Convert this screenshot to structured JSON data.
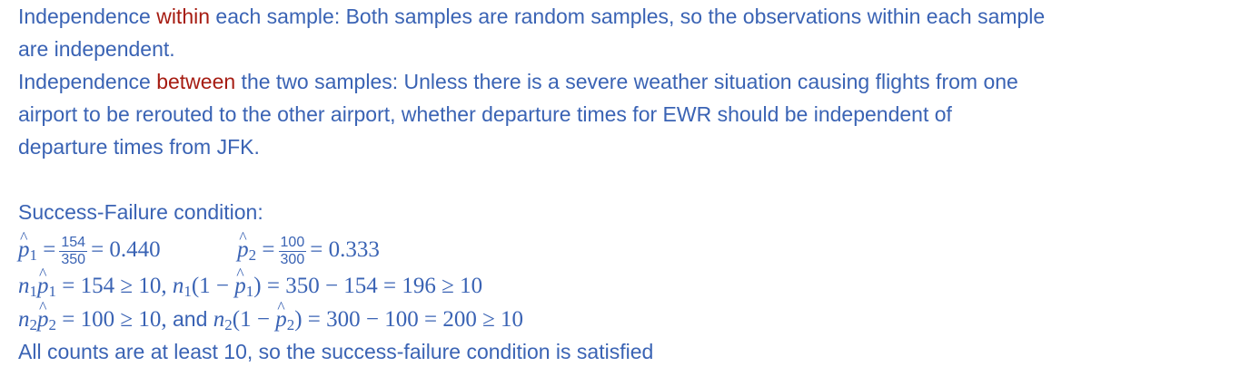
{
  "independence_within": {
    "pre": "Independence ",
    "keyword": "within",
    "line1_rest": " each sample: Both samples are random samples, so the observations within each sample",
    "line2": "are independent."
  },
  "independence_between": {
    "pre": "Independence ",
    "keyword": "between",
    "line1_rest": " the two samples: Unless there is a severe weather situation causing flights from one",
    "line2": "airport to be rerouted to the other airport, whether departure times for EWR should be independent of",
    "line3": "departure times from JFK."
  },
  "success_failure": {
    "heading": "Success-Failure condition:",
    "p1": {
      "symbol": "p",
      "sub": "1",
      "num": "154",
      "den": "350",
      "result": "0.440"
    },
    "p2": {
      "symbol": "p",
      "sub": "2",
      "num": "100",
      "den": "300",
      "result": "0.333"
    },
    "eq1": {
      "n_sub": "1",
      "val1": "154 ≥ 10,",
      "rhs": "= 350 − 154 = 196 ≥ 10"
    },
    "eq2": {
      "n_sub": "2",
      "val1": "100 ≥ 10,",
      "conj": " and ",
      "rhs": "= 300 − 100 = 200 ≥ 10"
    },
    "conclusion": "All counts are at least 10, so the success-failure condition is satisfied"
  }
}
